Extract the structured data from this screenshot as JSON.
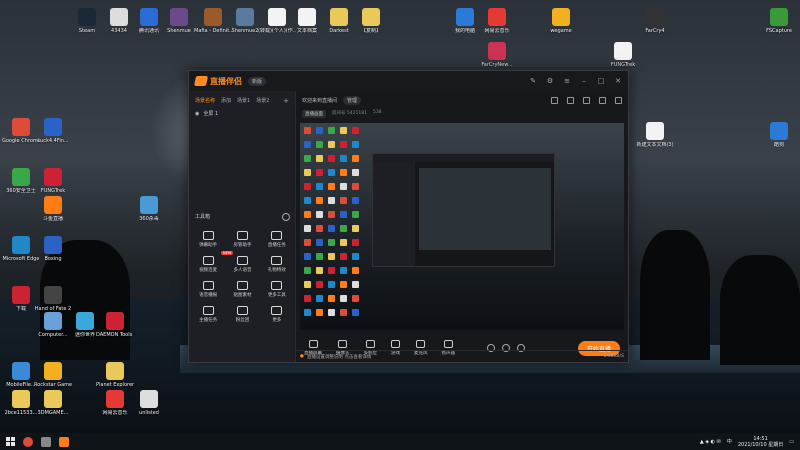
{
  "desktop": {
    "icons": [
      {
        "label": "Steam",
        "color": "#1b2838"
      },
      {
        "label": "43434",
        "color": "#ddd"
      },
      {
        "label": "腾讯通讯",
        "color": "#2a6cd6"
      },
      {
        "label": "Shenmue",
        "color": "#6a4a8a"
      },
      {
        "label": "Mafia - Definit...",
        "color": "#9a5a2a"
      },
      {
        "label": "Shenmue2",
        "color": "#5a7aa0"
      },
      {
        "label": "(转载)(个人)(作...",
        "color": "#f3f3f3"
      },
      {
        "label": "文本档案",
        "color": "#f3f3f3"
      },
      {
        "label": "Darkest",
        "color": "#e8c95a"
      },
      {
        "label": "【复制】",
        "color": "#e8c95a"
      },
      {
        "label": "Google Chrome",
        "color": "#dd4b39"
      },
      {
        "label": "Luck4.4Fin...",
        "color": "#2a62c8"
      },
      {
        "label": "360安全卫士",
        "color": "#3aa848"
      },
      {
        "label": "FUNGTrek",
        "color": "#cc2233"
      },
      {
        "label": "360杀毒",
        "color": "#4a9ad8"
      },
      {
        "label": "斗鱼直播",
        "color": "#ff7d14"
      },
      {
        "label": "Microsoft Edge",
        "color": "#1e88c8"
      },
      {
        "label": "Boxing",
        "color": "#2a62c8"
      },
      {
        "label": "下载",
        "color": "#cc2233"
      },
      {
        "label": "Hand of Fate 2",
        "color": "#444"
      },
      {
        "label": "迷你世界",
        "color": "#3aa8d8"
      },
      {
        "label": "Computer...",
        "color": "#6aa0d8"
      },
      {
        "label": "MobileFile...",
        "color": "#3a8ad8"
      },
      {
        "label": "Rockstar Games",
        "color": "#f0b020"
      },
      {
        "label": "2bce11533...",
        "color": "#e8c95a"
      },
      {
        "label": "3DMGAME...",
        "color": "#e8c95a"
      },
      {
        "label": "DAEMON Tools Lite",
        "color": "#cc2233"
      },
      {
        "label": "Planet Explorers",
        "color": "#e8c95a"
      },
      {
        "label": "网易云音乐",
        "color": "#e53935"
      },
      {
        "label": "unlisted",
        "color": "#ddd"
      },
      {
        "label": "我的电脑",
        "color": "#2a7ad8"
      },
      {
        "label": "网易云音乐",
        "color": "#e53935"
      },
      {
        "label": "wegame",
        "color": "#f0b020"
      },
      {
        "label": "FarCry4",
        "color": "#333"
      },
      {
        "label": "FSCapture",
        "color": "#3a9a3a"
      },
      {
        "label": "FarCryNew...",
        "color": "#cc3355"
      },
      {
        "label": "FUNGTrek",
        "color": "#f3f3f3"
      },
      {
        "label": "新建文本文档(3)",
        "color": "#f3f3f3"
      },
      {
        "label": "酷狗",
        "color": "#2a7ad8"
      }
    ]
  },
  "window": {
    "app_name": "直播伴侣",
    "version_badge": "新版",
    "sidebar": {
      "tabs": [
        "场景名称",
        "添加",
        "场景1",
        "场景2"
      ],
      "scene_row": "全屏 1",
      "tools_title": "工具箱",
      "tools": [
        {
          "label": "弹幕助手",
          "new": false
        },
        {
          "label": "房管助手",
          "new": false
        },
        {
          "label": "直播任务",
          "new": false
        },
        {
          "label": "视频连麦",
          "new": true
        },
        {
          "label": "多人语音",
          "new": false
        },
        {
          "label": "礼物特效",
          "new": false
        },
        {
          "label": "语音播报",
          "new": false
        },
        {
          "label": "贴图素材",
          "new": false
        },
        {
          "label": "更多工具",
          "new": false
        },
        {
          "label": "主播任务",
          "new": false
        },
        {
          "label": "粉丝团",
          "new": false
        },
        {
          "label": "更多",
          "new": false
        }
      ]
    },
    "main": {
      "welcome": "欢迎来到直播间",
      "chip": "管理",
      "sub_chip": "直播画面",
      "room_info": "房间号 5421181",
      "viewers": "538"
    },
    "controls": [
      "直播屏幕",
      "摄像头",
      "多机位",
      "游戏",
      "麦克风",
      "扬声器"
    ],
    "live_button": "开始直播",
    "status_left": "直播设置调整说明 点击查看详情",
    "status_right": "0.00KB/S"
  },
  "taskbar": {
    "time": "14:51",
    "date": "2021/10/10 星期日",
    "ime": "中"
  }
}
